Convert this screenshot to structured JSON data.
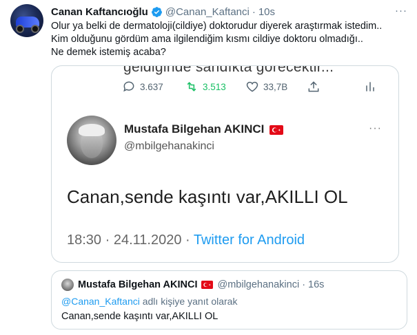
{
  "tweet": {
    "author_name": "Canan Kaftancıoğlu",
    "handle": "@Canan_Kaftanci",
    "separator": "·",
    "time": "10s",
    "more": "···",
    "lines": [
      "Olur ya belki de dermatoloji(cildiye) doktorudur diyerek araştırmak istedim..",
      "Kim olduğunu gördüm ama ilgilendiğim kısmı cildiye doktoru olmadığı..",
      "Ne demek istemiş acaba?"
    ]
  },
  "embedded_screenshot": {
    "clipped_text": "geldiğinde sandıkta görecektir...",
    "actions": {
      "replies": "3.637",
      "retweets": "3.513",
      "likes": "33,7B"
    },
    "author_name": "Mustafa Bilgehan AKINCI",
    "handle": "@mbilgehanakinci",
    "more": "···",
    "text": "Canan,sende kaşıntı var,AKILLI OL",
    "timestamp": "18:30 · 24.11.2020 · ",
    "app": "Twitter for Android"
  },
  "quoted_tweet": {
    "author_name": "Mustafa Bilgehan AKINCI",
    "handle": "@mbilgehanakinci",
    "separator": "·",
    "time": "16s",
    "reply_mention": "@Canan_Kaftanci",
    "reply_suffix": " adlı kişiye yanıt olarak",
    "text": "Canan,sende kaşıntı var,AKILLI OL"
  },
  "colors": {
    "accent": "#1d9bf0",
    "retweet_green": "#17bf63",
    "flag_red": "#e30a17",
    "muted": "#5b7083"
  }
}
